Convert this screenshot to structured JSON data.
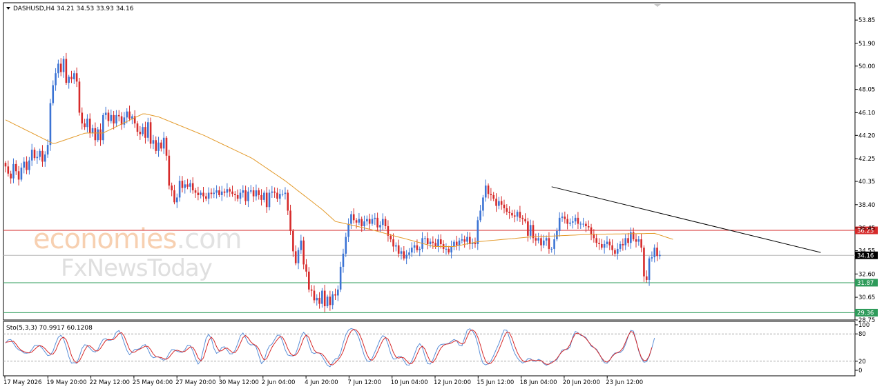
{
  "chart_data": [
    {
      "type": "candlestick",
      "symbol_line": "DASHUSD,H4  34.21 34.53 33.93 34.16",
      "ylim": [
        28.75,
        55.3
      ],
      "y_ticks": [
        "53.85",
        "51.90",
        "50.00",
        "48.05",
        "46.10",
        "44.20",
        "42.25",
        "40.35",
        "38.40",
        "36.45",
        "34.55",
        "32.60",
        "30.65",
        "28.75"
      ],
      "x_ticks": [
        "17 May 2026",
        "19 May 20:00",
        "22 May 12:00",
        "25 May 04:00",
        "27 May 20:00",
        "30 May 12:00",
        "2 Jun 04:00",
        "4 Jun 20:00",
        "7 Jun 12:00",
        "10 Jun 04:00",
        "12 Jun 20:00",
        "15 Jun 12:00",
        "18 Jun 04:00",
        "20 Jun 20:00",
        "23 Jun 12:00"
      ],
      "close_series": [
        41.6,
        41.0,
        40.6,
        41.8,
        41.2,
        40.5,
        41.5,
        42.0,
        41.3,
        42.1,
        43.0,
        42.3,
        42.4,
        42.9,
        42.0,
        42.6,
        43.4,
        46.9,
        48.4,
        49.4,
        50.2,
        49.5,
        50.6,
        48.6,
        49.1,
        48.9,
        49.4,
        48.7,
        46.1,
        45.2,
        44.9,
        45.6,
        44.4,
        44.8,
        43.8,
        44.7,
        43.8,
        45.9,
        46.1,
        45.4,
        45.9,
        45.2,
        45.9,
        45.8,
        45.1,
        45.7,
        46.2,
        45.6,
        45.8,
        45.2,
        44.5,
        44.3,
        44.9,
        44.0,
        45.3,
        43.5,
        43.8,
        42.9,
        43.6,
        43.1,
        44.0,
        42.5,
        40.0,
        39.6,
        38.6,
        39.0,
        40.4,
        39.8,
        40.1,
        39.9,
        40.2,
        39.6,
        39.4,
        39.2,
        39.4,
        39.1,
        38.9,
        39.4,
        39.3,
        39.4,
        39.6,
        39.2,
        39.5,
        39.4,
        39.7,
        39.5,
        39.3,
        39.2,
        38.9,
        39.4,
        39.6,
        38.7,
        39.5,
        39.6,
        39.1,
        39.6,
        39.2,
        38.8,
        39.4,
        38.2,
        39.4,
        39.5,
        39.4,
        38.9,
        39.3,
        39.3,
        39.4,
        37.9,
        36.2,
        34.5,
        33.5,
        34.6,
        35.4,
        33.4,
        32.8,
        31.3,
        31.2,
        30.4,
        30.6,
        30.1,
        31.2,
        29.9,
        30.7,
        30.0,
        30.9,
        30.8,
        31.3,
        33.2,
        34.3,
        35.7,
        36.8,
        37.6,
        37.1,
        36.9,
        37.2,
        36.6,
        37.0,
        37.2,
        36.8,
        37.2,
        37.3,
        36.5,
        36.7,
        37.2,
        36.6,
        35.8,
        35.5,
        34.9,
        35.0,
        34.3,
        34.5,
        33.9,
        34.2,
        34.4,
        34.8,
        35.0,
        34.6,
        34.7,
        35.6,
        35.6,
        35.1,
        35.3,
        35.2,
        34.9,
        35.5,
        35.1,
        34.7,
        34.7,
        34.4,
        34.9,
        35.3,
        35.0,
        35.4,
        35.5,
        35.3,
        35.7,
        35.1,
        35.2,
        35.1,
        37.1,
        37.9,
        39.0,
        40.0,
        39.3,
        39.2,
        38.9,
        38.3,
        38.7,
        38.4,
        38.1,
        37.8,
        37.7,
        37.5,
        37.4,
        37.8,
        37.3,
        37.2,
        37.0,
        35.8,
        36.7,
        35.6,
        35.4,
        35.6,
        35.0,
        35.4,
        35.6,
        34.7,
        34.7,
        35.5,
        36.2,
        37.3,
        37.4,
        37.2,
        36.8,
        36.9,
        37.0,
        37.3,
        36.8,
        36.8,
        36.8,
        36.6,
        36.5,
        35.9,
        35.6,
        35.2,
        35.1,
        34.8,
        35.1,
        35.3,
        35.0,
        34.6,
        34.3,
        34.7,
        35.1,
        35.0,
        35.6,
        35.2,
        36.1,
        35.5,
        35.3,
        35.5,
        34.8,
        32.4,
        32.1,
        33.9,
        34.0,
        34.8,
        34.1,
        34.2
      ],
      "moving_average_series": [
        45.5,
        45.39,
        45.28,
        45.17,
        45.06,
        44.95,
        44.84,
        44.73,
        44.62,
        44.51,
        44.4,
        44.29,
        44.18,
        44.07,
        43.96,
        43.85,
        43.74,
        43.63,
        43.52,
        43.55,
        43.63,
        43.7,
        43.78,
        43.85,
        43.93,
        44.0,
        44.08,
        44.15,
        44.23,
        44.3,
        44.38,
        44.4,
        44.4,
        44.4,
        44.4,
        44.4,
        44.4,
        44.4,
        44.51,
        44.61,
        44.72,
        44.83,
        44.93,
        45.04,
        45.15,
        45.25,
        45.36,
        45.47,
        45.57,
        45.68,
        45.79,
        45.89,
        46.0,
        46.0,
        45.95,
        45.9,
        45.85,
        45.8,
        45.75,
        45.66,
        45.57,
        45.48,
        45.39,
        45.3,
        45.21,
        45.12,
        45.03,
        44.94,
        44.85,
        44.76,
        44.67,
        44.58,
        44.49,
        44.4,
        44.31,
        44.22,
        44.12,
        44.01,
        43.91,
        43.8,
        43.7,
        43.59,
        43.49,
        43.38,
        43.28,
        43.17,
        43.07,
        42.96,
        42.86,
        42.75,
        42.65,
        42.54,
        42.44,
        42.33,
        42.2,
        42.05,
        41.9,
        41.75,
        41.6,
        41.45,
        41.3,
        41.15,
        41.0,
        40.85,
        40.7,
        40.55,
        40.4,
        40.23,
        40.06,
        39.89,
        39.71,
        39.54,
        39.37,
        39.2,
        39.03,
        38.86,
        38.69,
        38.51,
        38.34,
        38.17,
        38.0,
        37.8,
        37.6,
        37.4,
        37.2,
        37.0,
        36.95,
        36.9,
        36.85,
        36.8,
        36.75,
        36.7,
        36.65,
        36.6,
        36.55,
        36.5,
        36.45,
        36.4,
        36.35,
        36.29,
        36.23,
        36.17,
        36.11,
        36.05,
        35.99,
        35.93,
        35.87,
        35.81,
        35.75,
        35.69,
        35.63,
        35.58,
        35.52,
        35.46,
        35.4,
        35.34,
        35.28,
        35.22,
        35.16,
        35.1,
        35.04,
        34.98,
        34.92,
        34.9,
        34.9,
        34.9,
        34.9,
        34.9,
        34.9,
        34.9,
        34.9,
        34.94,
        34.99,
        35.03,
        35.08,
        35.12,
        35.17,
        35.21,
        35.26,
        35.3,
        35.32,
        35.34,
        35.36,
        35.38,
        35.4,
        35.42,
        35.44,
        35.46,
        35.48,
        35.5,
        35.52,
        35.54,
        35.55,
        35.57,
        35.6,
        35.62,
        35.64,
        35.66,
        35.68,
        35.7,
        35.71,
        35.72,
        35.73,
        35.74,
        35.75,
        35.76,
        35.77,
        35.77,
        35.78,
        35.79,
        35.8,
        35.81,
        35.82,
        35.83,
        35.84,
        35.85,
        35.86,
        35.87,
        35.88,
        35.89,
        35.9,
        35.91,
        35.92,
        35.92,
        35.92,
        35.93,
        35.93,
        35.93,
        35.94,
        35.94,
        35.94,
        35.95,
        35.95,
        35.95,
        35.96,
        35.96,
        35.96,
        35.97,
        35.97,
        35.97,
        35.98,
        35.98,
        35.98,
        35.99,
        35.99,
        35.99,
        36.0,
        35.93,
        35.86,
        35.79,
        35.71,
        35.64,
        35.57,
        35.5
      ],
      "trendline": {
        "from": [
          207,
          39.9
        ],
        "to": [
          309,
          34.4
        ]
      },
      "levels": [
        {
          "value": 36.25,
          "label": "36.25",
          "color": "#d62a2a"
        },
        {
          "value": 31.87,
          "label": "31.87",
          "color": "#2e9b5a"
        },
        {
          "value": 29.36,
          "label": "29.36",
          "color": "#2e9b5a"
        },
        {
          "value": 34.16,
          "label": "34.16",
          "color": "#000000"
        }
      ]
    },
    {
      "type": "line",
      "title": "Sto(5,3,3) 70.9917 60.1208",
      "ylim": [
        0,
        100
      ],
      "y_ticks": [
        "100",
        "80",
        "20",
        "0"
      ],
      "levels": [
        80,
        20
      ],
      "series": [
        {
          "color": "#5a8fd8",
          "values": [
            59.6,
            66.8,
            67.7,
            59.2,
            50.1,
            44.7,
            42.7,
            38.0,
            37.5,
            38.6,
            45.7,
            54.6,
            55.3,
            53.6,
            47.9,
            40.0,
            32.2,
            33.6,
            42.1,
            58.8,
            72.8,
            76.9,
            69.0,
            51.5,
            29.9,
            15.9,
            16.9,
            15.3,
            30.2,
            48.1,
            56.1,
            54.9,
            48.5,
            42.1,
            40.1,
            45.7,
            58.3,
            68.0,
            69.6,
            65.8,
            66.0,
            71.3,
            84.0,
            87.4,
            77.6,
            59.8,
            43.8,
            34.1,
            39.9,
            46.1,
            46.1,
            48.2,
            54.7,
            56.4,
            46.1,
            33.1,
            27.6,
            29.2,
            29.9,
            25.0,
            22.0,
            25.9,
            37.1,
            45.4,
            45.2,
            41.9,
            40.2,
            39.4,
            45.2,
            54.9,
            54.5,
            42.9,
            25.8,
            13.8,
            21.3,
            46.1,
            69.9,
            79.1,
            70.0,
            48.2,
            37.3,
            41.2,
            50.7,
            51.6,
            44.7,
            36.2,
            36.3,
            43.8,
            58.5,
            75.6,
            82.1,
            71.6,
            59.6,
            55.6,
            56.8,
            51.0,
            32.9,
            14.7,
            20.6,
            41.3,
            53.4,
            57.5,
            67.5,
            76.9,
            77.4,
            64.0,
            45.2,
            33.6,
            32.0,
            31.5,
            36.6,
            53.4,
            73.6,
            83.5,
            76.4,
            56.5,
            39.6,
            36.8,
            39.0,
            37.8,
            30.9,
            20.5,
            11.0,
            7.9,
            16.9,
            25.2,
            26.7,
            38.3,
            60.2,
            78.0,
            88.5,
            91.8,
            90.1,
            83.4,
            70.0,
            51.2,
            32.3,
            20.7,
            19.0,
            26.7,
            40.0,
            53.6,
            67.8,
            76.3,
            72.7,
            57.0,
            37.1,
            24.7,
            25.0,
            30.7,
            30.3,
            21.0,
            12.0,
            11.4,
            20.4,
            34.9,
            50.7,
            58.6,
            50.4,
            30.1,
            14.7,
            13.7,
            23.2,
            38.2,
            51.2,
            56.7,
            57.5,
            57.7,
            59.2,
            63.7,
            67.9,
            64.7,
            55.0,
            53.6,
            70.9,
            88.5,
            91.4,
            86.6,
            77.1,
            57.8,
            32.2,
            15.2,
            11.8,
            14.5,
            20.8,
            32.2,
            45.9,
            58.3,
            74.6,
            88.8,
            87.9,
            71.4,
            52.5,
            37.3,
            27.4,
            20.6,
            15.9,
            19.0,
            25.7,
            25.5,
            20.0,
            19.9,
            24.1,
            21.8,
            14.8,
            11.0,
            13.8,
            19.0,
            19.8,
            23.5,
            33.9,
            44.4,
            45.7,
            45.9,
            51.8,
            73.4,
            85.3,
            82.6,
            76.8,
            75.7,
            72.0,
            62.7,
            53.1,
            50.0,
            46.4,
            37.1,
            25.4,
            16.8,
            15.4,
            21.8,
            32.1,
            38.1,
            38.4,
            38.9,
            44.2,
            56.7,
            74.2,
            87.8,
            86.1,
            66.5,
            42.4,
            26.4,
            17.7,
            19.2,
            30.7,
            49.5,
            71.0
          ]
        },
        {
          "color": "#d62a2a",
          "values": [
            61.6,
            62.4,
            63.2,
            63.9,
            57.4,
            49.1,
            43.9,
            40.9,
            39.1,
            38.3,
            40.3,
            45.6,
            51.3,
            54.6,
            52.3,
            47.5,
            40.7,
            35.9,
            35.7,
            43.3,
            57.9,
            69.5,
            72.9,
            67.1,
            51.5,
            32.3,
            20.9,
            16.3,
            20.5,
            31.6,
            44.4,
            53.4,
            53.8,
            48.6,
            43.0,
            42.7,
            48.2,
            57.3,
            65.6,
            67.8,
            67.2,
            67.9,
            73.7,
            80.8,
            82.9,
            75.1,
            60.6,
            45.8,
            39.3,
            40.0,
            44.1,
            46.8,
            49.9,
            53.1,
            52.5,
            45.5,
            35.9,
            30.0,
            28.9,
            28.1,
            25.6,
            24.3,
            28.4,
            36.1,
            42.6,
            44.2,
            42.3,
            40.5,
            41.6,
            46.5,
            51.5,
            50.8,
            41.1,
            27.5,
            20.3,
            27.1,
            45.8,
            65.0,
            73.0,
            65.8,
            51.9,
            42.2,
            43.1,
            47.8,
            49.0,
            44.2,
            39.1,
            38.8,
            46.2,
            59.3,
            72.1,
            76.4,
            71.1,
            62.3,
            57.3,
            54.5,
            46.9,
            32.9,
            22.7,
            25.5,
            38.4,
            50.7,
            59.5,
            67.3,
            73.9,
            72.8,
            62.2,
            47.6,
            36.9,
            32.4,
            33.4,
            40.5,
            54.5,
            70.2,
            77.8,
            72.1,
            57.5,
            44.3,
            38.5,
            37.9,
            35.9,
            29.7,
            20.8,
            13.1,
            11.9,
            16.7,
            22.9,
            30.1,
            41.7,
            58.8,
            75.6,
            86.1,
            90.1,
            88.4,
            81.2,
            68.2,
            51.2,
            34.7,
            24.0,
            22.1,
            28.6,
            40.1,
            53.8,
            65.9,
            72.3,
            68.7,
            55.6,
            39.6,
            29.0,
            26.8,
            28.7,
            27.3,
            21.1,
            14.8,
            14.6,
            22.2,
            35.3,
            48.1,
            53.2,
            46.4,
            31.7,
            19.5,
            17.2,
            25.0,
            37.7,
            48.7,
            55.1,
            57.3,
            58.1,
            60.2,
            63.6,
            65.4,
            61.1,
            57.8,
            60.3,
            73.8,
            86.3,
            88.8,
            84.5,
            73.0,
            55.7,
            35.0,
            19.9,
            13.9,
            15.7,
            22.5,
            32.9,
            45.1,
            59.4,
            74.0,
            83.8,
            82.7,
            70.5,
            53.7,
            39.1,
            28.4,
            21.3,
            18.2,
            19.9,
            22.8,
            22.3,
            21.2,
            21.8,
            21.5,
            16.6,
            13.2,
            13.4,
            16.4,
            20.1,
            25.8,
            34.4,
            41.3,
            45.1,
            47.8,
            57.0,
            70.1,
            80.4,
            81.7,
            78.3,
            74.8,
            70.1,
            62.6,
            55.2,
            50.3,
            44.8,
            36.1,
            26.9,
            19.9,
            18.0,
            22.5,
            30.7,
            36.4,
            39.0,
            42.0,
            48.9,
            61.7,
            75.8,
            85.6,
            82.8,
            65.1,
            44.3,
            28.3,
            21.0,
            22.3,
            32.0,
            50.4
          ]
        }
      ]
    }
  ],
  "watermark": {
    "line1_a": "economies",
    "line1_b": ".com",
    "line2": "FxNewsToday"
  },
  "pointer_marker_icon": "triangle-down-icon"
}
